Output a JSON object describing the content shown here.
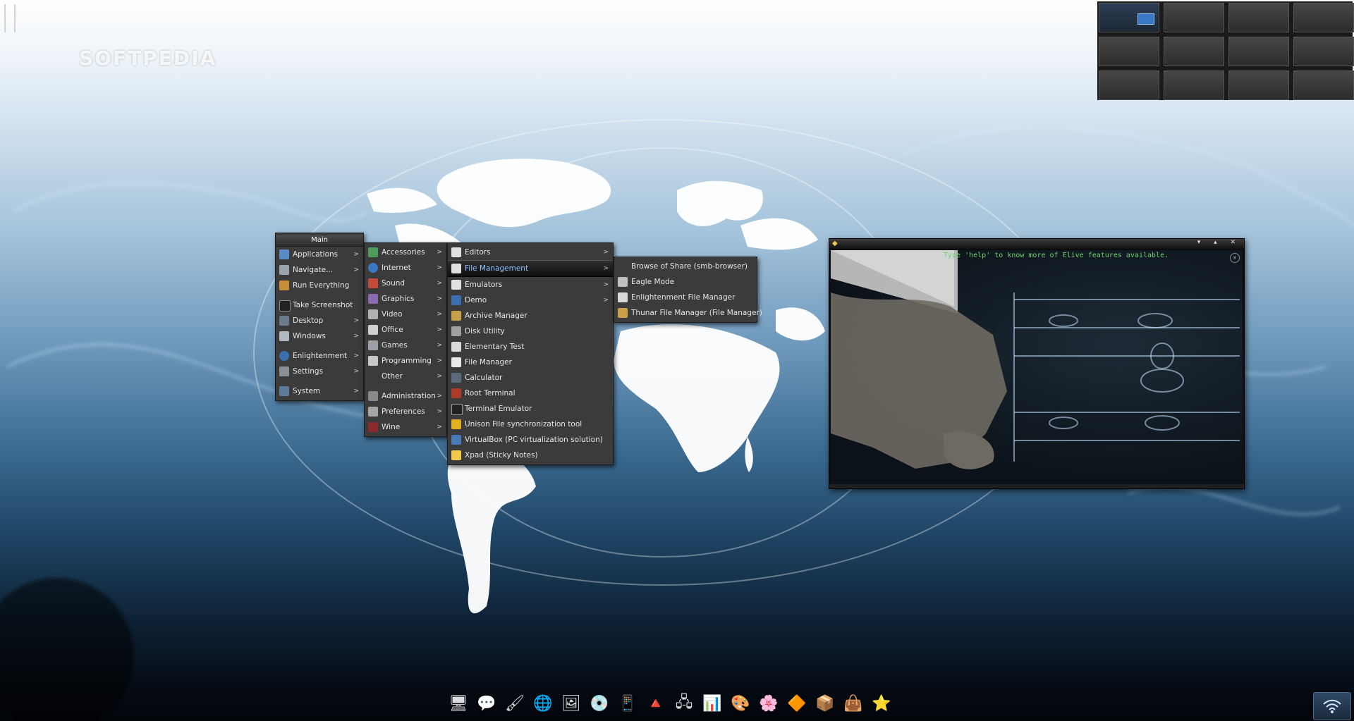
{
  "watermark": "SOFTPEDIA",
  "pager": {
    "rows": 3,
    "cols": 4,
    "active_index": 0
  },
  "main_menu": {
    "title": "Main",
    "items": [
      {
        "label": "Applications",
        "submenu": true,
        "icon": "applications-icon"
      },
      {
        "label": "Navigate...",
        "submenu": true,
        "icon": "navigate-icon"
      },
      {
        "label": "Run Everything",
        "submenu": false,
        "icon": "run-everything-icon"
      },
      {
        "label": "Take Screenshot",
        "submenu": false,
        "icon": "camera-icon"
      },
      {
        "label": "Desktop",
        "submenu": true,
        "icon": "desktop-icon"
      },
      {
        "label": "Windows",
        "submenu": true,
        "icon": "windows-icon"
      },
      {
        "label": "Enlightenment",
        "submenu": true,
        "icon": "enlightenment-icon"
      },
      {
        "label": "Settings",
        "submenu": true,
        "icon": "settings-icon"
      },
      {
        "label": "System",
        "submenu": true,
        "icon": "system-icon"
      }
    ]
  },
  "applications_menu": {
    "items": [
      {
        "label": "Accessories",
        "icon": "accessories-icon"
      },
      {
        "label": "Internet",
        "icon": "internet-icon"
      },
      {
        "label": "Sound",
        "icon": "sound-icon"
      },
      {
        "label": "Graphics",
        "icon": "graphics-icon"
      },
      {
        "label": "Video",
        "icon": "video-icon"
      },
      {
        "label": "Office",
        "icon": "office-icon"
      },
      {
        "label": "Games",
        "icon": "games-icon"
      },
      {
        "label": "Programming",
        "icon": "programming-icon"
      },
      {
        "label": "Other",
        "icon": ""
      },
      {
        "label": "Administration",
        "icon": "administration-icon"
      },
      {
        "label": "Preferences",
        "icon": "preferences-icon"
      },
      {
        "label": "Wine",
        "icon": "wine-icon"
      }
    ]
  },
  "accessories_menu": {
    "items": [
      {
        "label": "Editors",
        "submenu": true,
        "icon": "editors-icon"
      },
      {
        "label": "File Management",
        "submenu": true,
        "icon": "file-management-icon",
        "selected": true
      },
      {
        "label": "Emulators",
        "submenu": true,
        "icon": "emulators-icon"
      },
      {
        "label": "Demo",
        "submenu": true,
        "icon": "demo-icon"
      },
      {
        "label": "Archive Manager",
        "submenu": false,
        "icon": "archive-manager-icon"
      },
      {
        "label": "Disk Utility",
        "submenu": false,
        "icon": "disk-utility-icon"
      },
      {
        "label": "Elementary Test",
        "submenu": false,
        "icon": "elementary-test-icon"
      },
      {
        "label": "File Manager",
        "submenu": false,
        "icon": "file-manager-icon"
      },
      {
        "label": "Calculator",
        "submenu": false,
        "icon": "calculator-icon"
      },
      {
        "label": "Root Terminal",
        "submenu": false,
        "icon": "root-terminal-icon"
      },
      {
        "label": "Terminal Emulator",
        "submenu": false,
        "icon": "terminal-icon"
      },
      {
        "label": "Unison File synchronization tool",
        "submenu": false,
        "icon": "unison-icon"
      },
      {
        "label": "VirtualBox (PC virtualization solution)",
        "submenu": false,
        "icon": "virtualbox-icon"
      },
      {
        "label": "Xpad (Sticky Notes)",
        "submenu": false,
        "icon": "xpad-icon"
      }
    ]
  },
  "file_management_menu": {
    "items": [
      {
        "label": "Browse of Share (smb-browser)",
        "icon": ""
      },
      {
        "label": "Eagle Mode",
        "icon": "eagle-mode-icon"
      },
      {
        "label": "Enlightenment File Manager",
        "icon": "efm-icon"
      },
      {
        "label": "Thunar File Manager (File Manager)",
        "icon": "thunar-icon"
      }
    ]
  },
  "window": {
    "title": "",
    "message": "Type 'help' to know more of Elive features available.",
    "controls": "▾ ▴ ✕"
  },
  "dock": {
    "items": [
      {
        "name": "computer-icon",
        "glyph": "🖥"
      },
      {
        "name": "chat-icon",
        "glyph": "💬"
      },
      {
        "name": "paint-roller-icon",
        "glyph": "🖌"
      },
      {
        "name": "globe-browser-icon",
        "glyph": "🌐"
      },
      {
        "name": "image-viewer-icon",
        "glyph": "🖼"
      },
      {
        "name": "media-disc-icon",
        "glyph": "💿"
      },
      {
        "name": "ipod-icon",
        "glyph": "📱"
      },
      {
        "name": "vlc-cone-icon",
        "glyph": "🔺"
      },
      {
        "name": "remote-desktop-icon",
        "glyph": "🖧"
      },
      {
        "name": "system-monitor-icon",
        "glyph": "📊"
      },
      {
        "name": "color-wheel-icon",
        "glyph": "🎨"
      },
      {
        "name": "flower-gallery-icon",
        "glyph": "🌸"
      },
      {
        "name": "blender-icon",
        "glyph": "🔶"
      },
      {
        "name": "package-box-icon",
        "glyph": "📦"
      },
      {
        "name": "shopping-bag-icon",
        "glyph": "👜"
      },
      {
        "name": "star-icon",
        "glyph": "⭐"
      }
    ]
  },
  "tray": {
    "wifi_icon": "wifi-icon"
  }
}
